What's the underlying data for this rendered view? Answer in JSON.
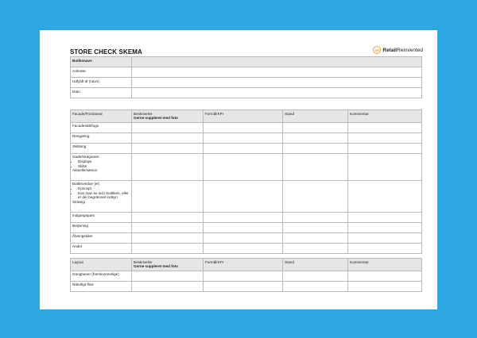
{
  "title": "STORE CHECK SKEMA",
  "logo": {
    "mark": "RR",
    "bold": "Retail",
    "light": "Reinvented"
  },
  "info_rows": [
    "Butiksnavn",
    "Adresse",
    "Udfyldt af (navn)",
    "Dato"
  ],
  "facade": {
    "headers": [
      "Facade/Frontareal",
      "Beskrivelse",
      "Formål/KPI",
      "Stand",
      "Kommentar"
    ],
    "desc_sub": "Gerne suppleret med foto",
    "rows": {
      "r1": "Facadeskilt/logo",
      "r2": "Rengøring",
      "r3": "Skiltning",
      "r4": {
        "label": "Gade/strøgvarer",
        "bullets": [
          "Displays",
          "Skilte"
        ],
        "tail": "Aktuelle/sæson"
      },
      "r5": {
        "label": "Butiksvindue (er)",
        "bullets": [
          "Koncept",
          "Kan man se ind i butikken, eller er der begrænset indsyn"
        ],
        "tail": "Strategi"
      },
      "r6": "Indgangsparti",
      "r7": "Belysning",
      "r8": "Åbningstider",
      "r9": "Andet"
    }
  },
  "layout": {
    "headers": [
      "Layout",
      "Beskrivelse",
      "Formål/KPI",
      "Stand",
      "Kommentar"
    ],
    "desc_sub": "Gerne suppleret med foto",
    "rows": [
      "Gangbaner (fremkommelige)",
      "Naturligt flow"
    ]
  }
}
